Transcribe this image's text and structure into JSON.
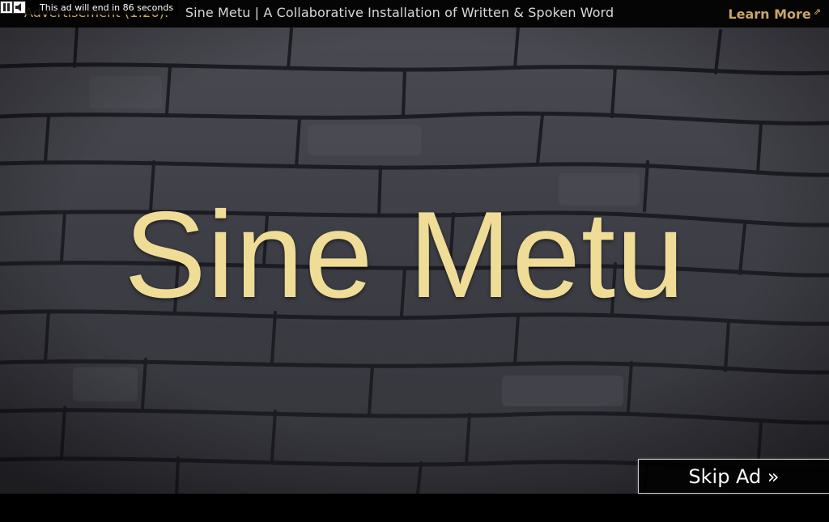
{
  "countdown": {
    "text": "This ad will end in 86 seconds",
    "icons": [
      "pause-icon",
      "volume-icon"
    ]
  },
  "ad_bar": {
    "label": "Advertisement",
    "duration": "(1:26):",
    "title": "Sine Metu | A Collaborative Installation of Written & Spoken Word",
    "learn_more": "Learn More",
    "learn_more_icon": "external-link-icon"
  },
  "video": {
    "title_text": "Sine Metu",
    "title_color": "#efdc96"
  },
  "skip_ad": {
    "label": "Skip Ad »"
  },
  "colors": {
    "accent": "#c9a664",
    "bar_background": "#050505"
  }
}
